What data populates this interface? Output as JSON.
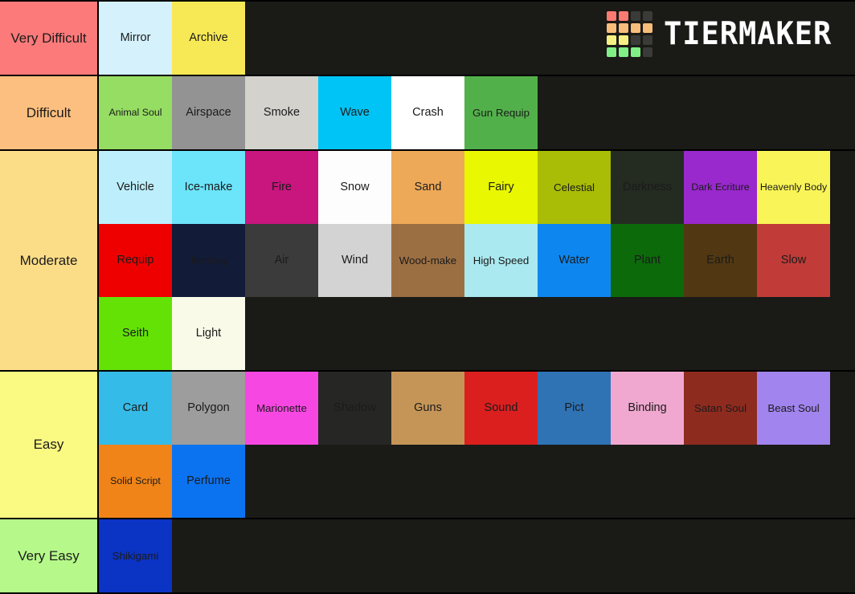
{
  "brand": {
    "name": "TIERMAKER",
    "logo_grid_colors": [
      "#fa7b72",
      "#fa7b72",
      "#3a3a38",
      "#3a3a38",
      "#f7bd7a",
      "#f7bd7a",
      "#f7bd7a",
      "#f7bd7a",
      "#f7f183",
      "#f7f183",
      "#3a3a38",
      "#3a3a38",
      "#82ef86",
      "#82ef86",
      "#82ef86",
      "#3a3a38"
    ],
    "wordmark_color": "#ffffff"
  },
  "page": {
    "background": "#1a1a17",
    "border_color": "#000000",
    "default_text_color": "#1b1b1b"
  },
  "tiers": [
    {
      "label": "Very Difficult",
      "label_color": "#fc7a7a",
      "items": [
        {
          "label": "Mirror",
          "color": "#d4f1fc"
        },
        {
          "label": "Archive",
          "color": "#f7e855"
        }
      ]
    },
    {
      "label": "Difficult",
      "label_color": "#fcbf7f",
      "items": [
        {
          "label": "Animal Soul",
          "color": "#96dd63"
        },
        {
          "label": "Airspace",
          "color": "#939393"
        },
        {
          "label": "Smoke",
          "color": "#d4d2cd"
        },
        {
          "label": "Wave",
          "color": "#00c4f5"
        },
        {
          "label": "Crash",
          "color": "#ffffff"
        },
        {
          "label": "Gun Requip",
          "color": "#52b04a"
        }
      ]
    },
    {
      "label": "Moderate",
      "label_color": "#fcdd87",
      "items": [
        {
          "label": "Vehicle",
          "color": "#bdeefc"
        },
        {
          "label": "Ice-make",
          "color": "#6ce4f9"
        },
        {
          "label": "Fire",
          "color": "#c9157e"
        },
        {
          "label": "Snow",
          "color": "#fdfdfd"
        },
        {
          "label": "Sand",
          "color": "#eda958"
        },
        {
          "label": "Fairy",
          "color": "#e9f700"
        },
        {
          "label": "Celestial",
          "color": "#a9bc06"
        },
        {
          "label": "Darkness",
          "color": "#242b21"
        },
        {
          "label": "Dark Ecriture",
          "color": "#9928cd"
        },
        {
          "label": "Heavenly Body",
          "color": "#f9f457"
        },
        {
          "label": "Requip",
          "color": "#ef0000"
        },
        {
          "label": "Territory",
          "color": "#121b37"
        },
        {
          "label": "Air",
          "color": "#3b3b3b"
        },
        {
          "label": "Wind",
          "color": "#d3d3d3"
        },
        {
          "label": "Wood-make",
          "color": "#9c6f43"
        },
        {
          "label": "High Speed",
          "color": "#aae9ef"
        },
        {
          "label": "Water",
          "color": "#0d87ef"
        },
        {
          "label": "Plant",
          "color": "#0c6a0b"
        },
        {
          "label": "Earth",
          "color": "#513812"
        },
        {
          "label": "Slow",
          "color": "#c13c38"
        },
        {
          "label": "Seith",
          "color": "#64e206"
        },
        {
          "label": "Light",
          "color": "#fafae9"
        }
      ]
    },
    {
      "label": "Easy",
      "label_color": "#fafa83",
      "items": [
        {
          "label": "Card",
          "color": "#35bbe8"
        },
        {
          "label": "Polygon",
          "color": "#9d9d9d"
        },
        {
          "label": "Marionette",
          "color": "#f747e3"
        },
        {
          "label": "Shadow",
          "color": "#262624"
        },
        {
          "label": "Guns",
          "color": "#c59557"
        },
        {
          "label": "Sound",
          "color": "#db1f1f"
        },
        {
          "label": "Pict",
          "color": "#2f73b5"
        },
        {
          "label": "Binding",
          "color": "#f0a8d0"
        },
        {
          "label": "Satan Soul",
          "color": "#8e2b1f"
        },
        {
          "label": "Beast Soul",
          "color": "#a184ed"
        },
        {
          "label": "Solid Script",
          "color": "#f08418"
        },
        {
          "label": "Perfume",
          "color": "#0b73f0"
        }
      ]
    },
    {
      "label": "Very Easy",
      "label_color": "#b6f98a",
      "items": [
        {
          "label": "Shikigami",
          "color": "#0b33c4"
        }
      ]
    }
  ]
}
